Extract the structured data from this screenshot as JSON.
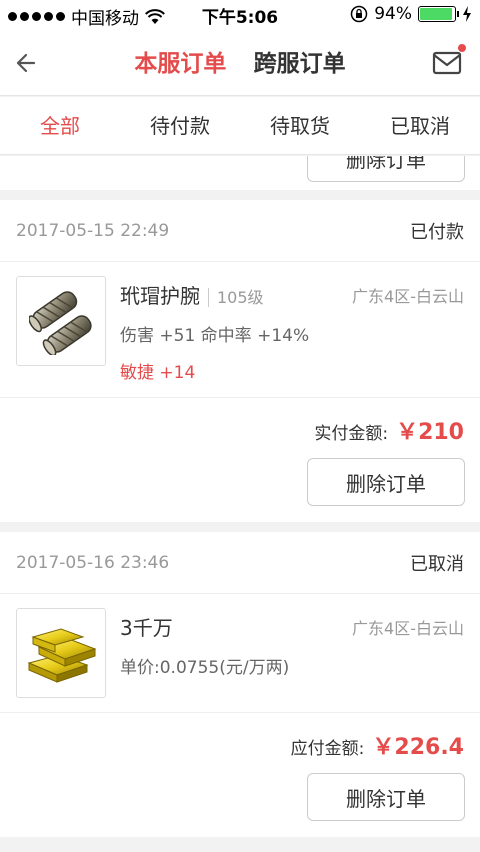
{
  "status_bar": {
    "carrier": "中国移动",
    "time": "下午5:06",
    "battery": "94%"
  },
  "nav": {
    "tab_local": "本服订单",
    "tab_cross": "跨服订单"
  },
  "filters": [
    "全部",
    "待付款",
    "待取货",
    "已取消"
  ],
  "partial_button": "删除订单",
  "orders": [
    {
      "time": "2017-05-15 22:49",
      "status": "已付款",
      "item_name": "玳瑁护腕",
      "level": "105级",
      "region": "广东4区-白云山",
      "attr_line": "伤害 +51 命中率 +14%",
      "attr_red": "敏捷 +14",
      "total_label": "实付金额:",
      "total_amount": "￥210",
      "delete_label": "删除订单",
      "icon": "bracer-icon"
    },
    {
      "time": "2017-05-16 23:46",
      "status": "已取消",
      "item_name": "3千万",
      "region": "广东4区-白云山",
      "attr_line": "单价:0.0755(元/万两)",
      "total_label": "应付金额:",
      "total_amount": "￥226.4",
      "delete_label": "删除订单",
      "icon": "gold-bars-icon"
    }
  ],
  "colors": {
    "accent": "#e44c4c"
  }
}
